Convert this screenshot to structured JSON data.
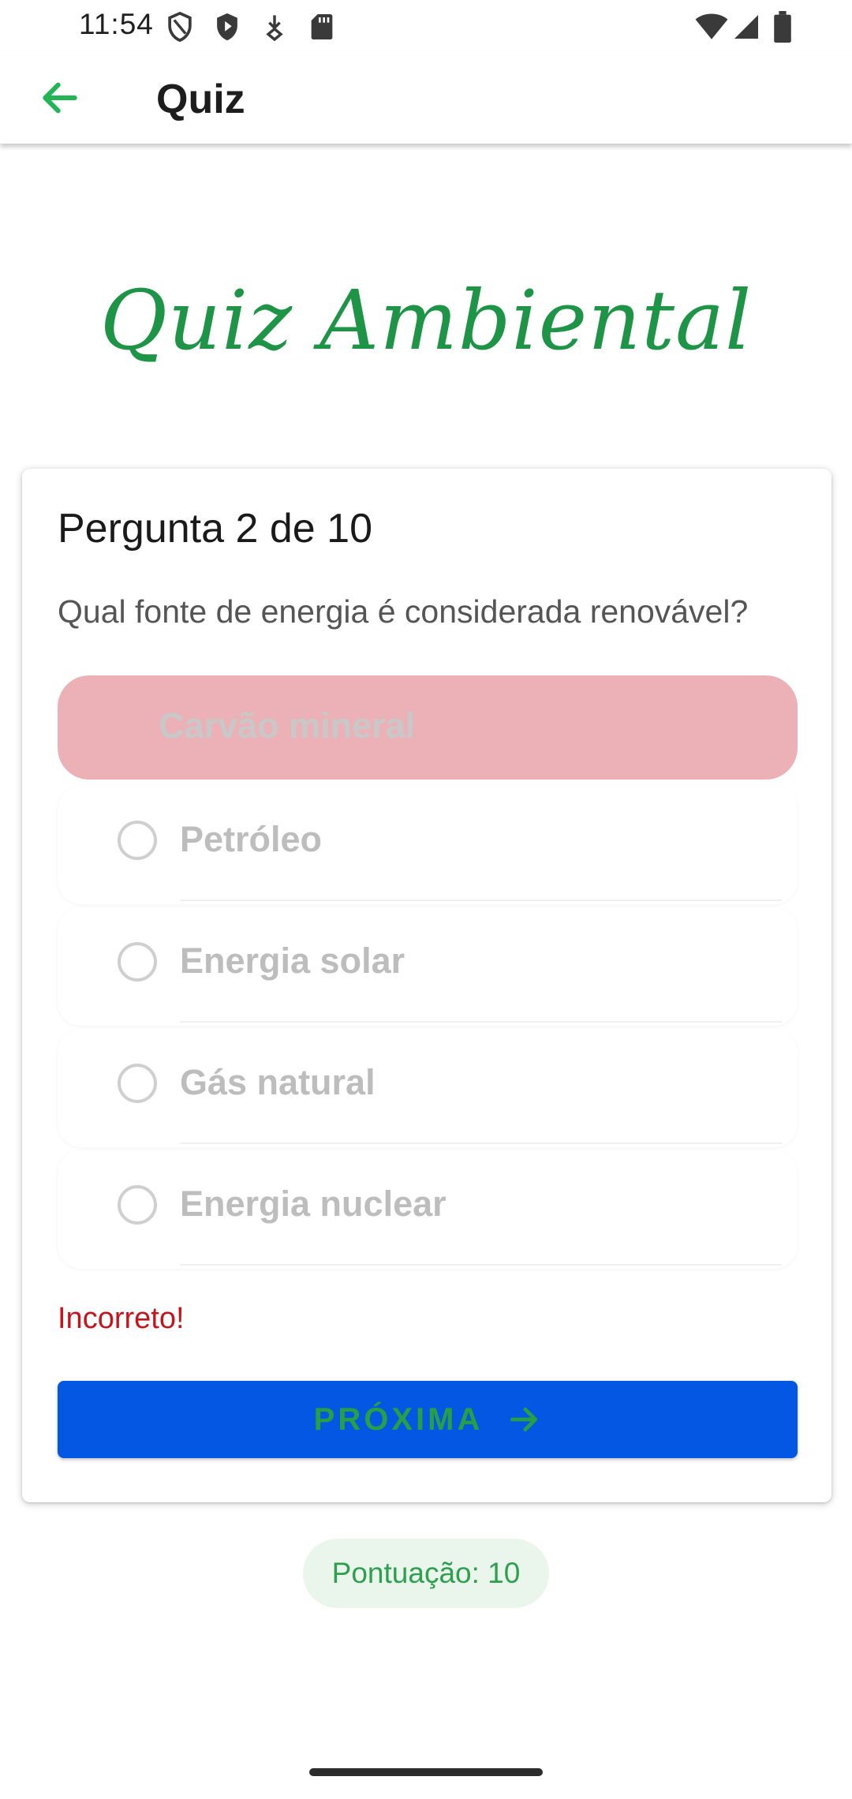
{
  "status_bar": {
    "time": "11:54",
    "icons": [
      "shield-outline-icon",
      "shield-play-icon",
      "download-icon",
      "sd-card-icon",
      "wifi-icon",
      "cellular-signal-icon",
      "battery-icon"
    ]
  },
  "app_bar": {
    "back_icon": "arrow-back-icon",
    "title": "Quiz"
  },
  "quiz": {
    "heading": "Quiz Ambiental",
    "question_counter": "Pergunta 2 de 10",
    "question": "Qual fonte de energia é considerada renovável?",
    "selected_option": "Carvão mineral",
    "options": [
      "Petróleo",
      "Energia solar",
      "Gás natural",
      "Energia nuclear"
    ],
    "feedback": "Incorreto!",
    "next_label": "PRÓXIMA",
    "next_icon": "arrow-forward-icon"
  },
  "score": {
    "label": "Pontuação: 10"
  },
  "colors": {
    "accent_green": "#1e9447",
    "button_blue": "#0457e3",
    "incorrect_fill": "#ecb1b7",
    "error_red": "#c5141c"
  }
}
